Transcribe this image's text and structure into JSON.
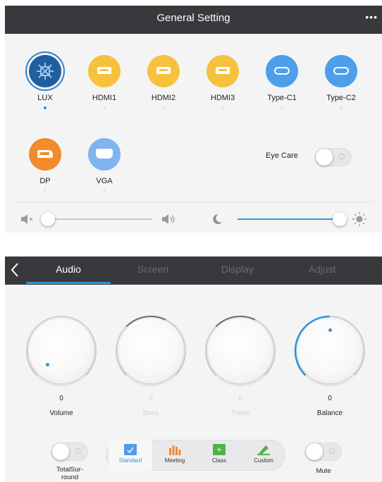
{
  "general_setting": {
    "title": "General Setting",
    "more_icon": "more-dots-icon",
    "sources": [
      {
        "label": "LUX",
        "icon": "lux-icon",
        "selected": true
      },
      {
        "label": "HDMI1",
        "icon": "hdmi-icon"
      },
      {
        "label": "HDMI2",
        "icon": "hdmi-icon"
      },
      {
        "label": "HDMI3",
        "icon": "hdmi-icon"
      },
      {
        "label": "Type-C1",
        "icon": "type-c-icon"
      },
      {
        "label": "Type-C2",
        "icon": "type-c-icon"
      },
      {
        "label": "DP",
        "icon": "displayport-icon"
      },
      {
        "label": "VGA",
        "icon": "vga-icon"
      }
    ],
    "eye_care": {
      "label": "Eye Care",
      "on": false
    },
    "volume_slider": {
      "level": 0.0
    },
    "brightness_slider": {
      "level": 1.0
    },
    "colors": {
      "accent": "#2f95d8",
      "header": "#38393c",
      "hdmi": "#f6c23e",
      "typec": "#4e9ee9",
      "dp": "#f28a2e",
      "vga": "#7fb4ef"
    }
  },
  "audio_settings": {
    "tabs": [
      {
        "label": "Audio",
        "active": true
      },
      {
        "label": "Screen",
        "active": false
      },
      {
        "label": "Display",
        "active": false
      },
      {
        "label": "Adjust",
        "active": false
      }
    ],
    "knobs": [
      {
        "value": "0",
        "label": "Volume",
        "enabled": true
      },
      {
        "value": "0",
        "label": "Bass",
        "enabled": false
      },
      {
        "value": "0",
        "label": "Treble",
        "enabled": false
      },
      {
        "value": "0",
        "label": "Balance",
        "enabled": true
      }
    ],
    "total_surround": {
      "label_line1": "TotalSur-",
      "label_line2": "round",
      "on": false
    },
    "sound_modes": [
      {
        "label": "Standard",
        "icon": "standard-mode-icon",
        "active": true
      },
      {
        "label": "Meeting",
        "icon": "meeting-mode-icon",
        "active": false
      },
      {
        "label": "Class",
        "icon": "class-mode-icon",
        "active": false
      },
      {
        "label": "Custom",
        "icon": "custom-mode-icon",
        "active": false
      }
    ],
    "mute": {
      "label": "Mute",
      "on": false
    }
  }
}
